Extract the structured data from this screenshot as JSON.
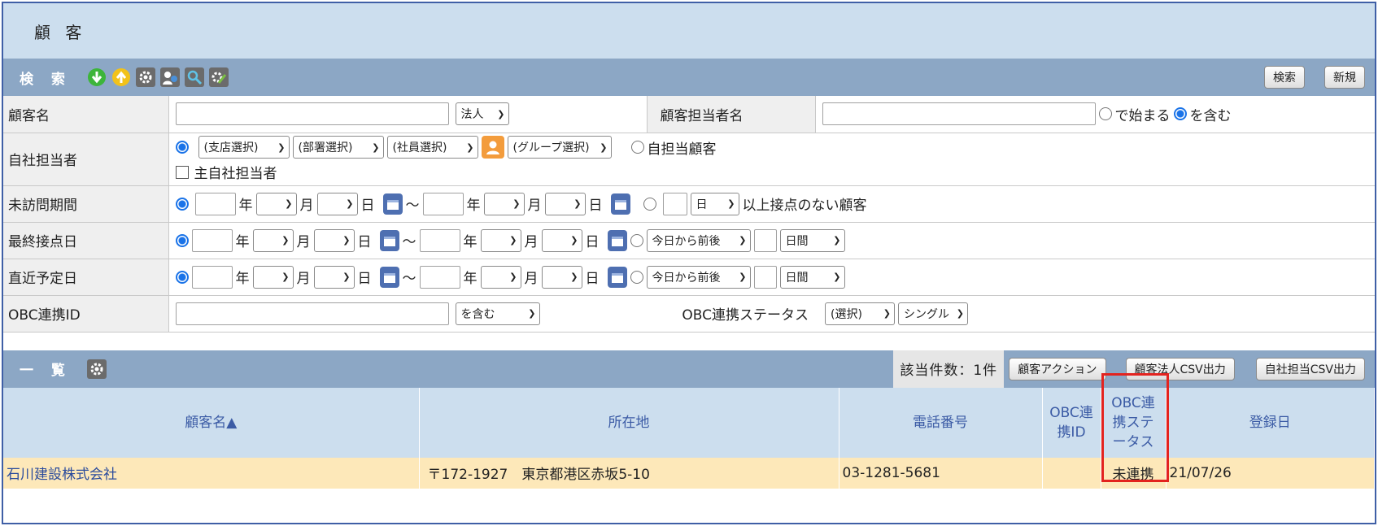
{
  "page_title": "顧 客",
  "search": {
    "label": "検 索",
    "buttons": {
      "search": "検索",
      "new": "新規"
    },
    "rows": {
      "customer_name": {
        "label": "顧客名",
        "type_select": "法人",
        "staff_label": "顧客担当者名",
        "match_start": "で始まる",
        "match_contain": "を含む"
      },
      "own_staff": {
        "label": "自社担当者",
        "branch": "(支店選択)",
        "dept": "(部署選択)",
        "employee": "(社員選択)",
        "group": "(グループ選択)",
        "own_customer": "自担当顧客",
        "main_staff": "主自社担当者"
      },
      "unvisited": {
        "label": "未訪問期間",
        "year": "年",
        "month": "月",
        "day": "日",
        "tilde": "～",
        "unit": "日",
        "suffix": "以上接点のない顧客"
      },
      "last_contact": {
        "label": "最終接点日",
        "year": "年",
        "month": "月",
        "day": "日",
        "tilde": "～",
        "relative": "今日から前後",
        "period": "日間"
      },
      "next_schedule": {
        "label": "直近予定日",
        "year": "年",
        "month": "月",
        "day": "日",
        "tilde": "～",
        "relative": "今日から前後",
        "period": "日間"
      },
      "obc": {
        "label": "OBC連携ID",
        "match": "を含む",
        "status_label": "OBC連携ステータス",
        "status_select": "(選択)",
        "mode_select": "シングル"
      }
    }
  },
  "list": {
    "label": "一 覧",
    "count": "該当件数：1件",
    "buttons": {
      "action": "顧客アクション",
      "csv_corp": "顧客法人CSV出力",
      "csv_staff": "自社担当CSV出力"
    },
    "headers": {
      "name": "顧客名▲",
      "address": "所在地",
      "phone": "電話番号",
      "obc_id": "OBC連携ID",
      "obc_status": "OBC連携ステータス",
      "registered": "登録日"
    },
    "rows": [
      {
        "name": "石川建設株式会社",
        "address": "〒172-1927　東京都港区赤坂5-10",
        "phone": "03-1281-5681",
        "obc_id": "",
        "obc_status": "未連携",
        "registered": "21/07/26"
      }
    ]
  }
}
